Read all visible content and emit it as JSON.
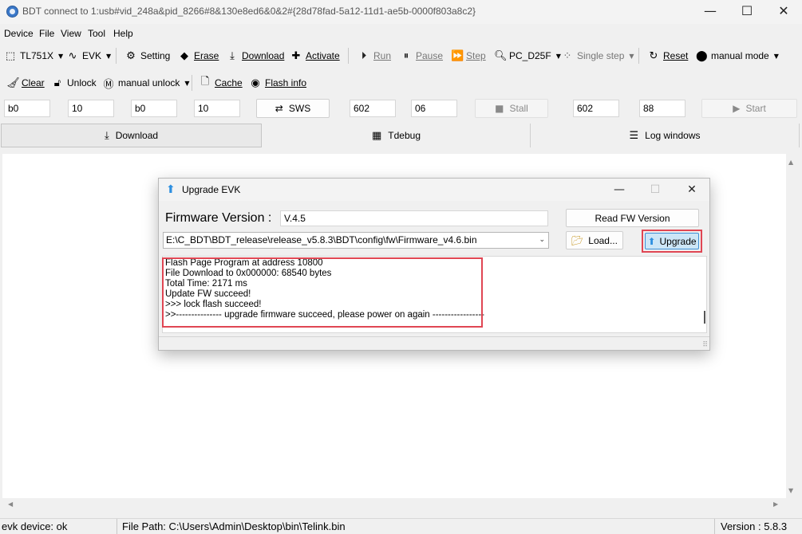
{
  "window": {
    "title": "BDT connect to 1:usb#vid_248a&pid_8266#8&130e8ed6&0&2#{28d78fad-5a12-11d1-ae5b-0000f803a8c2}",
    "minimize": "—",
    "maximize": "☐",
    "close": "✕"
  },
  "menu": [
    "Device",
    "File",
    "View",
    "Tool",
    "Help"
  ],
  "toolbar1": {
    "chip": "TL751X",
    "board": "EVK",
    "setting": "Setting",
    "erase": "Erase",
    "download": "Download",
    "activate": "Activate",
    "run": "Run",
    "pause": "Pause",
    "step": "Step",
    "pc": "PC_D25F",
    "single_step": "Single step",
    "reset": "Reset",
    "mode": "manual mode"
  },
  "toolbar2": {
    "clear": "Clear",
    "unlock": "Unlock",
    "manual_unlock": "manual unlock",
    "cache": "Cache",
    "flash_info": "Flash info"
  },
  "fields": {
    "f1": "b0",
    "f2": "10",
    "f3": "b0",
    "f4": "10",
    "sws": "SWS",
    "f5": "602",
    "f6": "06",
    "stall": "Stall",
    "f7": "602",
    "f8": "88",
    "start": "Start"
  },
  "tabs": {
    "download": "Download",
    "tdebug": "Tdebug",
    "log": "Log windows"
  },
  "status": {
    "device": "evk device: ok",
    "file_path": "File Path:  C:\\Users\\Admin\\Desktop\\bin\\Telink.bin",
    "version": "Version : 5.8.3"
  },
  "dialog": {
    "title": "Upgrade EVK",
    "fw_label": "Firmware Version :",
    "fw_value": "V.4.5",
    "read_fw": "Read FW Version",
    "path": "E:\\C_BDT\\BDT_release\\release_v5.8.3\\BDT\\config\\fw\\Firmware_v4.6.bin",
    "load": "Load...",
    "upgrade": "Upgrade",
    "log": [
      "Flash Page Program at address 10800",
      "File Download to 0x000000: 68540 bytes",
      "Total Time: 2171 ms",
      "Update FW succeed!",
      ">>> lock flash succeed!",
      ">>--------------- upgrade firmware succeed, please power on again -----------------"
    ]
  },
  "highlight_color": "#e04653"
}
